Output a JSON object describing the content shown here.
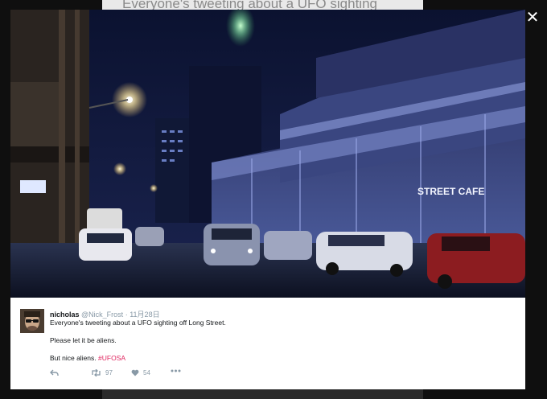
{
  "background_title": "Everyone's tweeting about a UFO sighting",
  "photo": {
    "sign_text": "STREET CAFE"
  },
  "tweet": {
    "display_name": "nicholas",
    "handle": "@Nick_Frost",
    "separator": "·",
    "date": "11月28日",
    "lines": [
      "Everyone's tweeting about a UFO sighting off Long Street.",
      "Please let it be aliens.",
      "But nice aliens."
    ],
    "hashtag": "#UFOSA",
    "retweet_count": "97",
    "like_count": "54"
  },
  "icons": {
    "close": "close-icon",
    "reply": "reply-icon",
    "retweet": "retweet-icon",
    "like": "heart-icon",
    "more": "more-dots-icon"
  },
  "colors": {
    "hashtag": "#e0245e",
    "meta": "#8899a6",
    "text": "#14171a"
  }
}
